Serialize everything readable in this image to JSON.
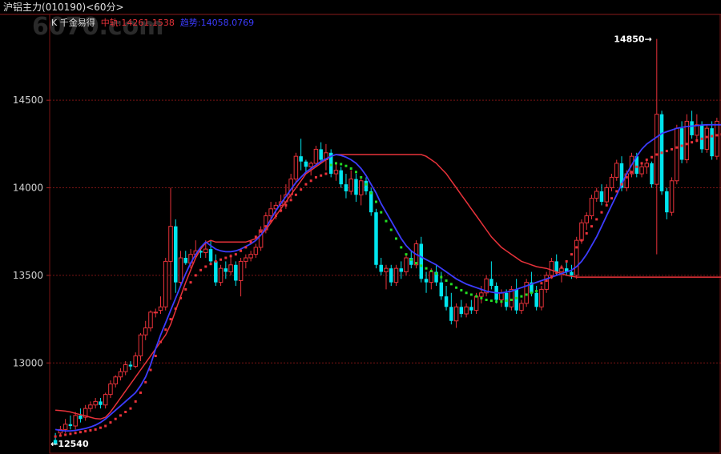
{
  "window": {
    "symbol": "沪铝主力",
    "code": "(010190)",
    "period": "<60分>"
  },
  "watermark": "6070.com",
  "legend": {
    "k_label": "K",
    "indicator_name": "千金易得",
    "mid_track": "中轨:14261.1538",
    "trend": "趋势:14058.0769"
  },
  "colors": {
    "background": "#000000",
    "up": "#e8323a",
    "down": "#00e5ee",
    "mid_line": "#e8323a",
    "trend_line": "#3c3cff",
    "grid": "#7a1414"
  },
  "chart_data": {
    "type": "candlestick",
    "ylim": [
      12480,
      14990
    ],
    "y_ticks": [
      13000,
      13500,
      14000,
      14500
    ],
    "grid": true,
    "annotations": [
      {
        "label": "14850",
        "value": 14850,
        "kind": "high"
      },
      {
        "label": "12540",
        "value": 12540,
        "kind": "low"
      }
    ],
    "candles": [
      [
        12560,
        12600,
        12530,
        12540
      ],
      [
        12600,
        12640,
        12580,
        12620
      ],
      [
        12620,
        12680,
        12600,
        12650
      ],
      [
        12650,
        12700,
        12620,
        12640
      ],
      [
        12640,
        12720,
        12620,
        12700
      ],
      [
        12700,
        12740,
        12660,
        12680
      ],
      [
        12690,
        12760,
        12670,
        12740
      ],
      [
        12740,
        12780,
        12720,
        12760
      ],
      [
        12760,
        12800,
        12740,
        12780
      ],
      [
        12780,
        12800,
        12740,
        12760
      ],
      [
        12760,
        12830,
        12740,
        12820
      ],
      [
        12820,
        12900,
        12800,
        12880
      ],
      [
        12880,
        12930,
        12860,
        12920
      ],
      [
        12920,
        12970,
        12900,
        12950
      ],
      [
        12950,
        13010,
        12930,
        12990
      ],
      [
        12990,
        13010,
        12960,
        12980
      ],
      [
        12980,
        13060,
        12970,
        13040
      ],
      [
        13040,
        13170,
        13010,
        13160
      ],
      [
        13160,
        13240,
        13130,
        13200
      ],
      [
        13200,
        13300,
        13180,
        13290
      ],
      [
        13290,
        13310,
        13260,
        13290
      ],
      [
        13300,
        13380,
        13280,
        13320
      ],
      [
        13320,
        13600,
        13300,
        13580
      ],
      [
        13580,
        14000,
        13360,
        13780
      ],
      [
        13780,
        13820,
        13400,
        13460
      ],
      [
        13460,
        13640,
        13440,
        13600
      ],
      [
        13600,
        13640,
        13560,
        13570
      ],
      [
        13570,
        13650,
        13540,
        13620
      ],
      [
        13620,
        13700,
        13600,
        13640
      ],
      [
        13640,
        13660,
        13600,
        13630
      ],
      [
        13630,
        13700,
        13600,
        13650
      ],
      [
        13650,
        13700,
        13560,
        13580
      ],
      [
        13580,
        13620,
        13440,
        13460
      ],
      [
        13460,
        13560,
        13440,
        13540
      ],
      [
        13540,
        13580,
        13480,
        13520
      ],
      [
        13520,
        13620,
        13500,
        13560
      ],
      [
        13560,
        13580,
        13440,
        13470
      ],
      [
        13470,
        13600,
        13380,
        13580
      ],
      [
        13580,
        13620,
        13540,
        13600
      ],
      [
        13600,
        13640,
        13580,
        13620
      ],
      [
        13620,
        13680,
        13600,
        13660
      ],
      [
        13660,
        13780,
        13640,
        13760
      ],
      [
        13760,
        13860,
        13740,
        13840
      ],
      [
        13840,
        13920,
        13800,
        13880
      ],
      [
        13880,
        13920,
        13820,
        13900
      ],
      [
        13900,
        13960,
        13860,
        13920
      ],
      [
        13920,
        14020,
        13880,
        13960
      ],
      [
        13960,
        14080,
        13940,
        14050
      ],
      [
        14050,
        14200,
        14030,
        14180
      ],
      [
        14180,
        14280,
        14100,
        14150
      ],
      [
        14150,
        14160,
        14080,
        14120
      ],
      [
        14120,
        14150,
        14070,
        14140
      ],
      [
        14140,
        14240,
        14120,
        14220
      ],
      [
        14220,
        14260,
        14140,
        14160
      ],
      [
        14160,
        14250,
        14100,
        14200
      ],
      [
        14200,
        14220,
        14060,
        14080
      ],
      [
        14080,
        14140,
        14040,
        14100
      ],
      [
        14100,
        14120,
        14000,
        14020
      ],
      [
        14020,
        14080,
        13940,
        13980
      ],
      [
        13980,
        14100,
        13960,
        14050
      ],
      [
        14050,
        14080,
        13920,
        13960
      ],
      [
        13960,
        14060,
        13900,
        14040
      ],
      [
        14040,
        14060,
        13960,
        13980
      ],
      [
        13980,
        14000,
        13840,
        13860
      ],
      [
        13860,
        13880,
        13540,
        13560
      ],
      [
        13560,
        13600,
        13500,
        13520
      ],
      [
        13520,
        13560,
        13420,
        13540
      ],
      [
        13540,
        13560,
        13440,
        13460
      ],
      [
        13460,
        13560,
        13440,
        13540
      ],
      [
        13540,
        13580,
        13480,
        13520
      ],
      [
        13520,
        13620,
        13500,
        13600
      ],
      [
        13600,
        13640,
        13540,
        13560
      ],
      [
        13560,
        13700,
        13540,
        13680
      ],
      [
        13680,
        13720,
        13460,
        13480
      ],
      [
        13480,
        13520,
        13400,
        13460
      ],
      [
        13460,
        13540,
        13420,
        13520
      ],
      [
        13520,
        13560,
        13440,
        13460
      ],
      [
        13460,
        13520,
        13360,
        13380
      ],
      [
        13380,
        13440,
        13300,
        13320
      ],
      [
        13320,
        13400,
        13220,
        13240
      ],
      [
        13240,
        13340,
        13200,
        13320
      ],
      [
        13320,
        13360,
        13260,
        13280
      ],
      [
        13280,
        13340,
        13260,
        13320
      ],
      [
        13320,
        13360,
        13280,
        13300
      ],
      [
        13300,
        13400,
        13280,
        13380
      ],
      [
        13380,
        13440,
        13340,
        13400
      ],
      [
        13400,
        13500,
        13380,
        13480
      ],
      [
        13480,
        13580,
        13420,
        13440
      ],
      [
        13440,
        13460,
        13340,
        13360
      ],
      [
        13360,
        13420,
        13320,
        13400
      ],
      [
        13400,
        13420,
        13300,
        13320
      ],
      [
        13320,
        13440,
        13300,
        13420
      ],
      [
        13420,
        13480,
        13280,
        13300
      ],
      [
        13300,
        13360,
        13280,
        13340
      ],
      [
        13340,
        13480,
        13320,
        13460
      ],
      [
        13460,
        13520,
        13380,
        13400
      ],
      [
        13400,
        13440,
        13300,
        13320
      ],
      [
        13320,
        13440,
        13300,
        13420
      ],
      [
        13420,
        13520,
        13400,
        13500
      ],
      [
        13500,
        13600,
        13480,
        13580
      ],
      [
        13580,
        13620,
        13500,
        13520
      ],
      [
        13520,
        13560,
        13460,
        13540
      ],
      [
        13540,
        13580,
        13500,
        13520
      ],
      [
        13520,
        13560,
        13480,
        13500
      ],
      [
        13500,
        13720,
        13480,
        13700
      ],
      [
        13700,
        13820,
        13680,
        13800
      ],
      [
        13800,
        13860,
        13760,
        13840
      ],
      [
        13840,
        13960,
        13820,
        13940
      ],
      [
        13940,
        14000,
        13920,
        13980
      ],
      [
        13980,
        14020,
        13900,
        13920
      ],
      [
        13920,
        14020,
        13900,
        14000
      ],
      [
        14000,
        14080,
        13980,
        14060
      ],
      [
        14060,
        14160,
        14040,
        14140
      ],
      [
        14140,
        14180,
        13980,
        14000
      ],
      [
        14000,
        14100,
        13980,
        14080
      ],
      [
        14080,
        14200,
        14060,
        14180
      ],
      [
        14180,
        14200,
        14060,
        14080
      ],
      [
        14080,
        14140,
        14060,
        14120
      ],
      [
        14120,
        14160,
        14080,
        14140
      ],
      [
        14140,
        14150,
        14000,
        14020
      ],
      [
        14020,
        14850,
        13620,
        14420
      ],
      [
        14420,
        14440,
        13960,
        13980
      ],
      [
        13980,
        14000,
        13820,
        13860
      ],
      [
        13860,
        14060,
        13840,
        14040
      ],
      [
        14040,
        14360,
        14020,
        14340
      ],
      [
        14340,
        14380,
        14140,
        14160
      ],
      [
        14160,
        14420,
        14140,
        14380
      ],
      [
        14380,
        14440,
        14280,
        14300
      ],
      [
        14300,
        14420,
        14260,
        14360
      ],
      [
        14360,
        14380,
        14200,
        14220
      ],
      [
        14220,
        14360,
        14200,
        14340
      ],
      [
        14340,
        14380,
        14160,
        14180
      ],
      [
        14180,
        14400,
        14160,
        14380
      ]
    ],
    "series": [
      {
        "name": "中轨",
        "values": [
          12730,
          12728,
          12725,
          12720,
          12712,
          12705,
          12698,
          12690,
          12682,
          12680,
          12690,
          12720,
          12760,
          12800,
          12840,
          12880,
          12920,
          12960,
          13000,
          13040,
          13080,
          13120,
          13160,
          13220,
          13300,
          13380,
          13460,
          13530,
          13600,
          13650,
          13685,
          13700,
          13690,
          13690,
          13690,
          13690,
          13690,
          13690,
          13690,
          13700,
          13710,
          13730,
          13760,
          13800,
          13840,
          13880,
          13920,
          13960,
          14000,
          14040,
          14080,
          14100,
          14120,
          14140,
          14160,
          14180,
          14190,
          14190,
          14190,
          14190,
          14190,
          14190,
          14190,
          14190,
          14190,
          14190,
          14190,
          14190,
          14190,
          14190,
          14190,
          14190,
          14190,
          14190,
          14180,
          14160,
          14140,
          14110,
          14080,
          14040,
          14000,
          13960,
          13920,
          13880,
          13840,
          13800,
          13760,
          13720,
          13690,
          13660,
          13640,
          13620,
          13600,
          13580,
          13570,
          13560,
          13550,
          13545,
          13540,
          13530,
          13520,
          13510,
          13500,
          13495,
          13490,
          13490,
          13490,
          13490,
          13490,
          13490,
          13490,
          13490,
          13490,
          13490,
          13490,
          13490,
          13490,
          13490,
          13490,
          13490,
          13490,
          13490,
          13490,
          13490,
          13490,
          13490,
          13490,
          13490,
          13490,
          13490,
          13490,
          13490,
          13490,
          13490,
          13490,
          13490,
          13490,
          13490,
          13490,
          13490,
          13490
        ]
      },
      {
        "name": "趋势",
        "values": [
          12620,
          12615,
          12612,
          12612,
          12615,
          12620,
          12626,
          12634,
          12645,
          12660,
          12680,
          12705,
          12730,
          12755,
          12780,
          12805,
          12830,
          12870,
          12920,
          12990,
          13080,
          13160,
          13230,
          13300,
          13370,
          13440,
          13510,
          13570,
          13620,
          13660,
          13690,
          13670,
          13650,
          13640,
          13635,
          13635,
          13640,
          13650,
          13665,
          13680,
          13700,
          13730,
          13770,
          13820,
          13870,
          13910,
          13950,
          13990,
          14030,
          14060,
          14090,
          14110,
          14130,
          14150,
          14165,
          14180,
          14190,
          14185,
          14175,
          14160,
          14140,
          14110,
          14070,
          14020,
          13970,
          13910,
          13860,
          13810,
          13760,
          13710,
          13670,
          13640,
          13620,
          13605,
          13590,
          13575,
          13560,
          13540,
          13520,
          13500,
          13480,
          13465,
          13450,
          13440,
          13430,
          13420,
          13410,
          13405,
          13400,
          13400,
          13405,
          13410,
          13420,
          13430,
          13440,
          13450,
          13460,
          13470,
          13480,
          13490,
          13500,
          13510,
          13520,
          13530,
          13550,
          13580,
          13620,
          13670,
          13720,
          13780,
          13840,
          13900,
          13960,
          14020,
          14080,
          14130,
          14180,
          14220,
          14250,
          14270,
          14290,
          14310,
          14320,
          14330,
          14340,
          14345,
          14350,
          14352,
          14355,
          14358,
          14360,
          14360,
          14360,
          14360,
          14360,
          14360,
          14360,
          14360,
          14360,
          14360,
          14360,
          14360
        ]
      },
      {
        "name": "stop",
        "values": [
          12580,
          12585,
          12590,
          12595,
          12600,
          12605,
          12610,
          12615,
          12620,
          12630,
          12640,
          12660,
          12680,
          12700,
          12720,
          12740,
          12780,
          12830,
          12890,
          12960,
          13040,
          13120,
          13190,
          13250,
          13310,
          13370,
          13420,
          13460,
          13500,
          13530,
          13550,
          13565,
          13580,
          13590,
          13600,
          13610,
          13620,
          13640,
          13660,
          13690,
          13720,
          13750,
          13780,
          13810,
          13840,
          13870,
          13900,
          13930,
          13960,
          13990,
          14020,
          14040,
          14060,
          14070,
          14080,
          14080,
          14080,
          14080,
          14080,
          14075,
          14070,
          14060,
          14040,
          14010,
          13980,
          13945,
          13910,
          13870,
          13830,
          13790,
          13750,
          13710,
          13670,
          13630,
          13590,
          13555,
          13520,
          13490,
          13460,
          13440,
          13420,
          13405,
          13395,
          13385,
          13380,
          13375,
          13370,
          13368,
          13366,
          13365,
          13366,
          13370,
          13380,
          13395,
          13410,
          13425,
          13440,
          13455,
          13470,
          13490,
          13515,
          13545,
          13580,
          13620,
          13660,
          13700,
          13740,
          13780,
          13820,
          13860,
          13900,
          13940,
          13980,
          14020,
          14060,
          14090,
          14120,
          14140,
          14160,
          14175,
          14190,
          14200,
          14210,
          14220,
          14230,
          14240,
          14250,
          14260,
          14270,
          14280,
          14290,
          14295,
          14300,
          14305,
          14310,
          14315,
          14320,
          14325,
          14330,
          14335
        ]
      }
    ]
  }
}
